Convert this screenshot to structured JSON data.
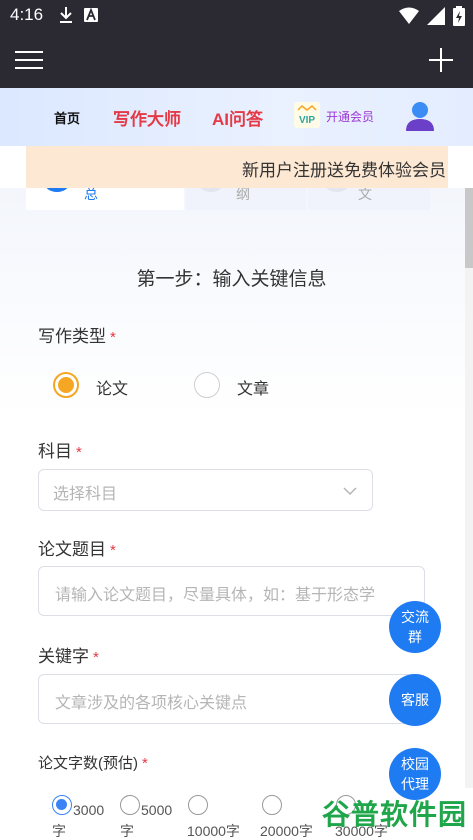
{
  "status": {
    "time": "4:16",
    "icons_left": [
      "download-icon",
      "a-icon"
    ],
    "icons_right": [
      "wifi-icon",
      "signal-icon",
      "battery-icon"
    ]
  },
  "appbar": {
    "icons": [
      "menu-icon",
      "plus-icon"
    ]
  },
  "nav": {
    "home": "首页",
    "writing_master": "写作大师",
    "ai_qa": "AI问答",
    "vip_badge": "VIP",
    "vip_label": "开通会员"
  },
  "notice": "新用户注册送免费体验会员",
  "steps": {
    "tab1_partial": "总",
    "tab2_partial": "纲",
    "tab3_partial": "文"
  },
  "form": {
    "step_title": "第一步：输入关键信息",
    "required_mark": "*",
    "writing_type": {
      "label": "写作类型",
      "options": [
        "论文",
        "文章"
      ],
      "selected": "论文"
    },
    "subject": {
      "label": "科目",
      "placeholder": "选择科目"
    },
    "title": {
      "label": "论文题目",
      "placeholder": "请输入论文题目，尽量具体，如：基于形态学"
    },
    "keywords": {
      "label": "关键字",
      "placeholder": "文章涉及的各项核心关键点"
    },
    "word_count": {
      "label": "论文字数(预估)",
      "options": [
        {
          "line1": "3000",
          "line2": "字"
        },
        {
          "line1": "5000",
          "line2": "字"
        },
        {
          "line1": "10000字",
          "line2": ""
        },
        {
          "line1": "20000字",
          "line2": ""
        },
        {
          "line1": "30000字",
          "line2": ""
        }
      ],
      "selected": "3000"
    }
  },
  "floating": {
    "group": "交流群",
    "service": "客服",
    "campus": "校园代理"
  },
  "watermark": "谷普软件园",
  "colors": {
    "accent_red": "#e53946",
    "accent_orange": "#f5a623",
    "accent_blue": "#1f7bf2",
    "vip_purple": "#9d37d6",
    "watermark_green": "#1fa64a"
  }
}
